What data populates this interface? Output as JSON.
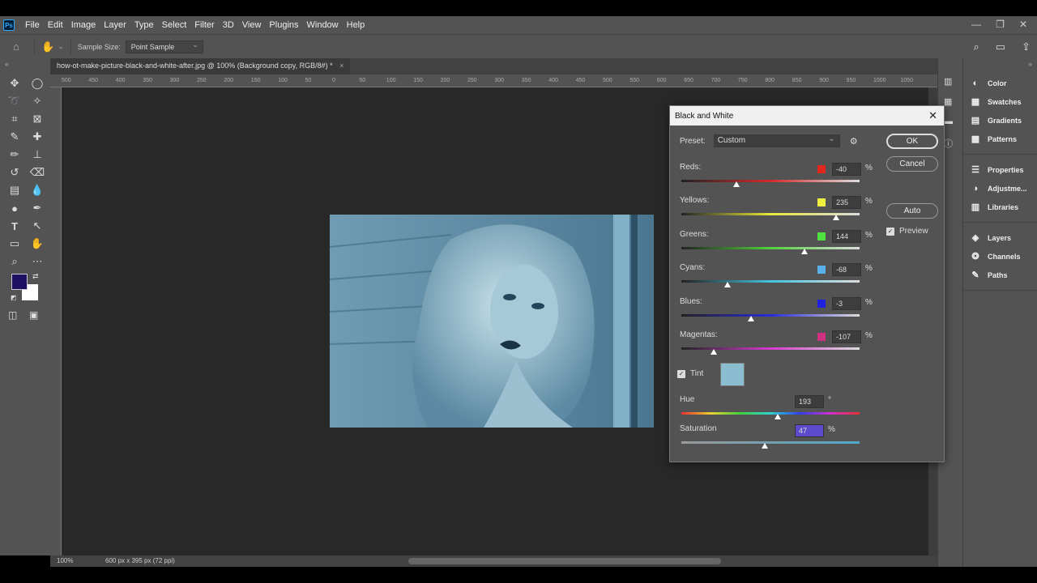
{
  "menubar": {
    "logo": "Ps",
    "items": [
      "File",
      "Edit",
      "Image",
      "Layer",
      "Type",
      "Select",
      "Filter",
      "3D",
      "View",
      "Plugins",
      "Window",
      "Help"
    ]
  },
  "options": {
    "sample_label": "Sample Size:",
    "sample_value": "Point Sample"
  },
  "document": {
    "tab_title": "how-ot-make-picture-black-and-white-after.jpg @ 100% (Background copy, RGB/8#) *",
    "zoom": "100%",
    "doc_info": "600 px x 395 px (72 ppi)"
  },
  "ruler_ticks": [
    "500",
    "450",
    "400",
    "350",
    "300",
    "250",
    "200",
    "150",
    "100",
    "50",
    "0",
    "50",
    "100",
    "150",
    "200",
    "250",
    "300",
    "350",
    "400",
    "450",
    "500",
    "550",
    "600",
    "650",
    "700",
    "750",
    "800",
    "850",
    "900",
    "950",
    "1000",
    "1050"
  ],
  "colors": {
    "foreground": "#1e1163",
    "background": "#ffffff",
    "tint": "#8bbdd0",
    "photo_tone": "#5a8aa3"
  },
  "panels": {
    "group1": [
      {
        "label": "Color",
        "icon": "color-wheel-icon"
      },
      {
        "label": "Swatches",
        "icon": "swatches-grid-icon"
      },
      {
        "label": "Gradients",
        "icon": "gradient-icon"
      },
      {
        "label": "Patterns",
        "icon": "patterns-grid-icon"
      }
    ],
    "group2": [
      {
        "label": "Properties",
        "icon": "properties-icon"
      },
      {
        "label": "Adjustme...",
        "icon": "adjustments-icon"
      },
      {
        "label": "Libraries",
        "icon": "libraries-icon"
      }
    ],
    "group3": [
      {
        "label": "Layers",
        "icon": "layers-icon"
      },
      {
        "label": "Channels",
        "icon": "channels-icon"
      },
      {
        "label": "Paths",
        "icon": "paths-icon"
      }
    ]
  },
  "dialog": {
    "title": "Black and White",
    "preset_label": "Preset:",
    "preset_value": "Custom",
    "ok": "OK",
    "cancel": "Cancel",
    "auto": "Auto",
    "preview": "Preview",
    "tint": "Tint",
    "sliders": [
      {
        "label": "Reds:",
        "value": "-40",
        "unit": "%",
        "swatch": "#e0281e",
        "level": 0.31,
        "track": "linear-gradient(90deg,#222,#d42a2a,#ddd)"
      },
      {
        "label": "Yellows:",
        "value": "235",
        "unit": "%",
        "swatch": "#f0f040",
        "level": 0.87,
        "track": "linear-gradient(90deg,#222,#e8e83a,#ddd)"
      },
      {
        "label": "Greens:",
        "value": "144",
        "unit": "%",
        "swatch": "#50e040",
        "level": 0.69,
        "track": "linear-gradient(90deg,#222,#4fd13a,#ddd)"
      },
      {
        "label": "Cyans:",
        "value": "-68",
        "unit": "%",
        "swatch": "#5ab0e8",
        "level": 0.26,
        "track": "linear-gradient(90deg,#222,#43c4e0,#ddd)"
      },
      {
        "label": "Blues:",
        "value": "-3",
        "unit": "%",
        "swatch": "#2020e0",
        "level": 0.39,
        "track": "linear-gradient(90deg,#222,#2a2ad8,#ddd)"
      },
      {
        "label": "Magentas:",
        "value": "-107",
        "unit": "%",
        "swatch": "#d03080",
        "level": 0.18,
        "track": "linear-gradient(90deg,#222,#d63ad0,#ddd)"
      }
    ],
    "hue": {
      "label": "Hue",
      "value": "193",
      "unit": "°",
      "level": 0.54
    },
    "saturation": {
      "label": "Saturation",
      "value": "47",
      "unit": "%",
      "level": 0.47
    }
  }
}
